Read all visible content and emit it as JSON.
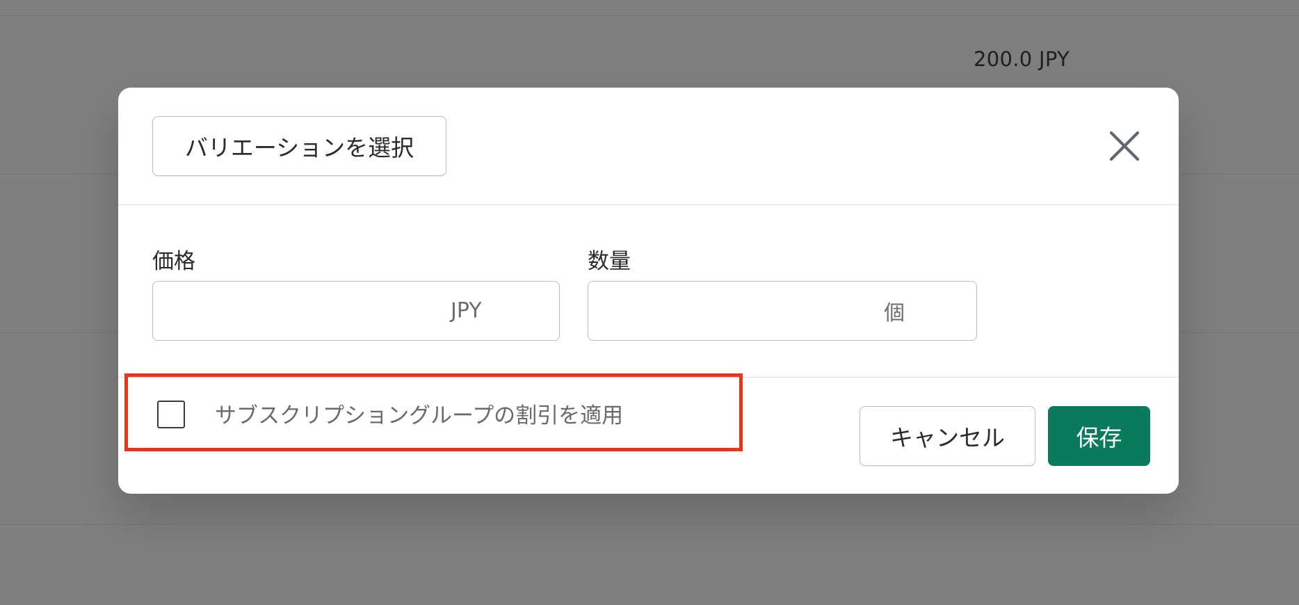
{
  "background": {
    "price_text": "200.0 JPY"
  },
  "modal": {
    "variation_button_label": "バリエーションを選択",
    "close_icon": "close-icon",
    "price": {
      "label": "価格",
      "value": "",
      "suffix": "JPY"
    },
    "quantity": {
      "label": "数量",
      "value": "",
      "suffix": "個"
    },
    "subscription_discount": {
      "label": "サブスクリプショングループの割引を適用",
      "checked": false
    },
    "cancel_label": "キャンセル",
    "save_label": "保存",
    "colors": {
      "save_button": "#097a5c",
      "highlight": "#f03216",
      "overlay": "#7f7f7f"
    }
  }
}
